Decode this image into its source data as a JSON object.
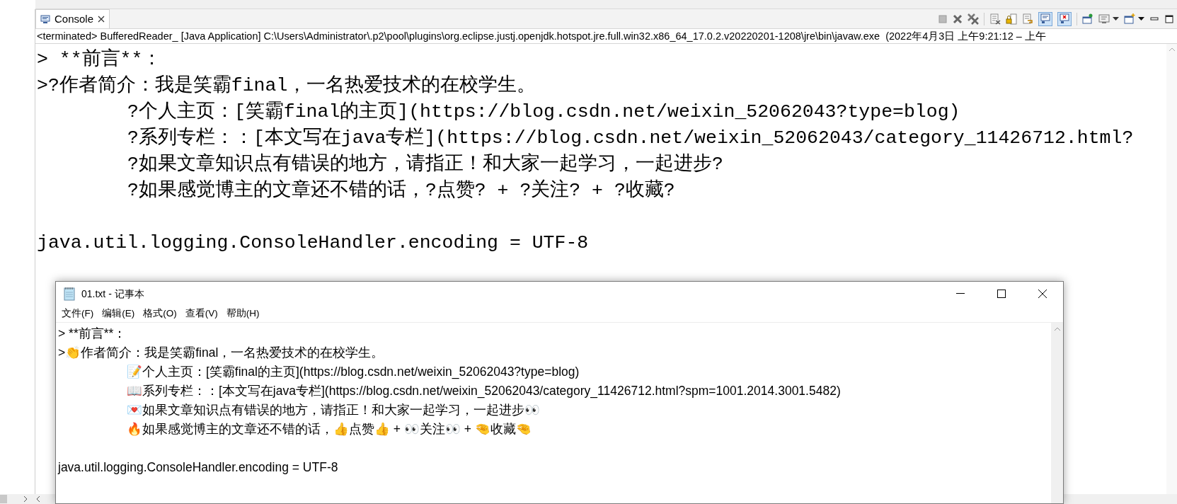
{
  "console_view": {
    "tab": {
      "label": "Console",
      "selected": true
    },
    "process_line": "<terminated> BufferedReader_ [Java Application] C:\\Users\\Administrator\\.p2\\pool\\plugins\\org.eclipse.justj.openjdk.hotspot.jre.full.win32.x86_64_17.0.2.v20220201-1208\\jre\\bin\\javaw.exe  (2022年4月3日 上午9:21:12 – 上午",
    "lines": [
      {
        "kind": "text",
        "text": "> **前言**：",
        "indent": false
      },
      {
        "kind": "text",
        "text": ">?作者简介：我是笑霸final，一名热爱技术的在校学生。",
        "indent": false
      },
      {
        "kind": "text",
        "text": "?个人主页：[笑霸final的主页](https://blog.csdn.net/weixin_52062043?type=blog)",
        "indent": true
      },
      {
        "kind": "text",
        "text": "?系列专栏：：[本文写在java专栏](https://blog.csdn.net/weixin_52062043/category_11426712.html?",
        "indent": true
      },
      {
        "kind": "text",
        "text": "?如果文章知识点有错误的地方，请指正！和大家一起学习，一起进步?",
        "indent": true
      },
      {
        "kind": "text",
        "text": "?如果感觉博主的文章还不错的话，?点赞? + ?关注? + ?收藏?",
        "indent": true
      },
      {
        "kind": "blank"
      },
      {
        "kind": "text",
        "text": "java.util.logging.ConsoleHandler.encoding = UTF-8",
        "indent": false
      }
    ]
  },
  "notepad": {
    "title": "01.txt - 记事本",
    "menu": [
      {
        "label": "文件(F)"
      },
      {
        "label": "编辑(E)"
      },
      {
        "label": "格式(O)"
      },
      {
        "label": "查看(V)"
      },
      {
        "label": "帮助(H)"
      }
    ],
    "lines": [
      {
        "kind": "text",
        "text": "> **前言**：",
        "indent": false
      },
      {
        "kind": "text",
        "text": ">👏作者简介：我是笑霸final，一名热爱技术的在校学生。",
        "indent": false
      },
      {
        "kind": "text",
        "text": "📝个人主页：[笑霸final的主页](https://blog.csdn.net/weixin_52062043?type=blog)",
        "indent": true
      },
      {
        "kind": "text",
        "text": "📖系列专栏：：[本文写在java专栏](https://blog.csdn.net/weixin_52062043/category_11426712.html?spm=1001.2014.3001.5482)",
        "indent": true
      },
      {
        "kind": "text",
        "text": "💌如果文章知识点有错误的地方，请指正！和大家一起学习，一起进步👀",
        "indent": true
      },
      {
        "kind": "text",
        "text": "🔥如果感觉博主的文章还不错的话，👍点赞👍 + 👀关注👀 + 🤏收藏🤏",
        "indent": true
      },
      {
        "kind": "blank"
      },
      {
        "kind": "text",
        "text": "java.util.logging.ConsoleHandler.encoding = UTF-8",
        "indent": false
      }
    ]
  }
}
